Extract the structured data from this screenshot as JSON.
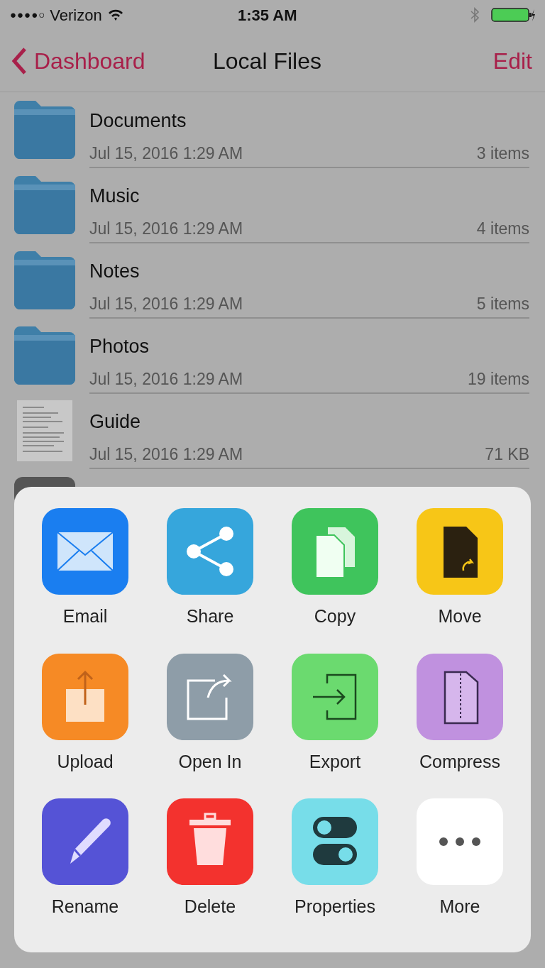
{
  "status_bar": {
    "signal_dots": "●●●●○",
    "carrier": "Verizon",
    "time": "1:35 AM"
  },
  "nav": {
    "back": "Dashboard",
    "title": "Local Files",
    "action": "Edit"
  },
  "files": [
    {
      "kind": "folder",
      "name": "Documents",
      "date": "Jul 15, 2016 1:29 AM",
      "size": "3 items"
    },
    {
      "kind": "folder",
      "name": "Music",
      "date": "Jul 15, 2016 1:29 AM",
      "size": "4 items"
    },
    {
      "kind": "folder",
      "name": "Notes",
      "date": "Jul 15, 2016 1:29 AM",
      "size": "5 items"
    },
    {
      "kind": "folder",
      "name": "Photos",
      "date": "Jul 15, 2016 1:29 AM",
      "size": "19 items"
    },
    {
      "kind": "document",
      "name": "Guide",
      "date": "Jul 15, 2016 1:29 AM",
      "size": "71 KB"
    }
  ],
  "actions": [
    {
      "kind": "email",
      "label": "Email",
      "color": "#1a7ef0"
    },
    {
      "kind": "share",
      "label": "Share",
      "color": "#36a6dc"
    },
    {
      "kind": "copy",
      "label": "Copy",
      "color": "#3fc45c"
    },
    {
      "kind": "move",
      "label": "Move",
      "color": "#f7c617"
    },
    {
      "kind": "upload",
      "label": "Upload",
      "color": "#f68a25"
    },
    {
      "kind": "openin",
      "label": "Open In",
      "color": "#8e9da8"
    },
    {
      "kind": "export",
      "label": "Export",
      "color": "#6bda6f"
    },
    {
      "kind": "compress",
      "label": "Compress",
      "color": "#c091df"
    },
    {
      "kind": "rename",
      "label": "Rename",
      "color": "#5553d6"
    },
    {
      "kind": "delete",
      "label": "Delete",
      "color": "#f3322e"
    },
    {
      "kind": "properties",
      "label": "Properties",
      "color": "#77dde9"
    },
    {
      "kind": "more",
      "label": "More",
      "color": "#ffffff"
    }
  ]
}
